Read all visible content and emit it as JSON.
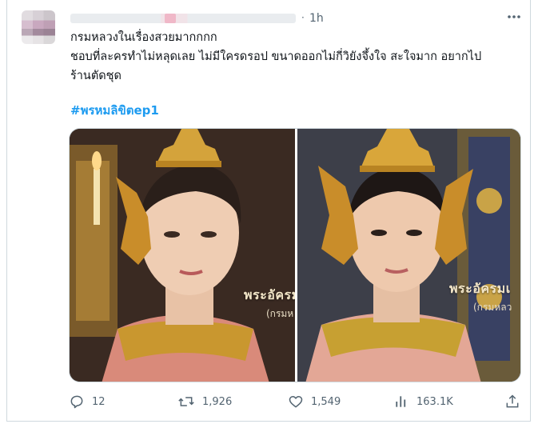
{
  "post": {
    "time": "1h",
    "dot": "·",
    "lines": [
      "กรมหลวงในเรื่องสวยมากกกก",
      "ชอบที่ละครทำไม่หลุดเลย ไม่มีใครดรอป ขนาดออกไม่กี่วิยังจึ้งใจ สะใจมาก อยากไป",
      "ร้านตัดชุด"
    ],
    "hashtag": "#พรหมลิขิตep1",
    "media": {
      "left_caption": "พระอัครม",
      "left_subcaption": "(กรมห",
      "right_caption": "พระอัครมเ",
      "right_subcaption": "(กรมหลว"
    },
    "stats": {
      "replies": "12",
      "reposts": "1,926",
      "likes": "1,549",
      "views": "163.1K"
    }
  },
  "icons": {
    "more": "more-horizontal-icon",
    "reply": "reply-icon",
    "repost": "repost-icon",
    "like": "heart-icon",
    "views": "views-chart-icon",
    "share": "share-icon"
  }
}
